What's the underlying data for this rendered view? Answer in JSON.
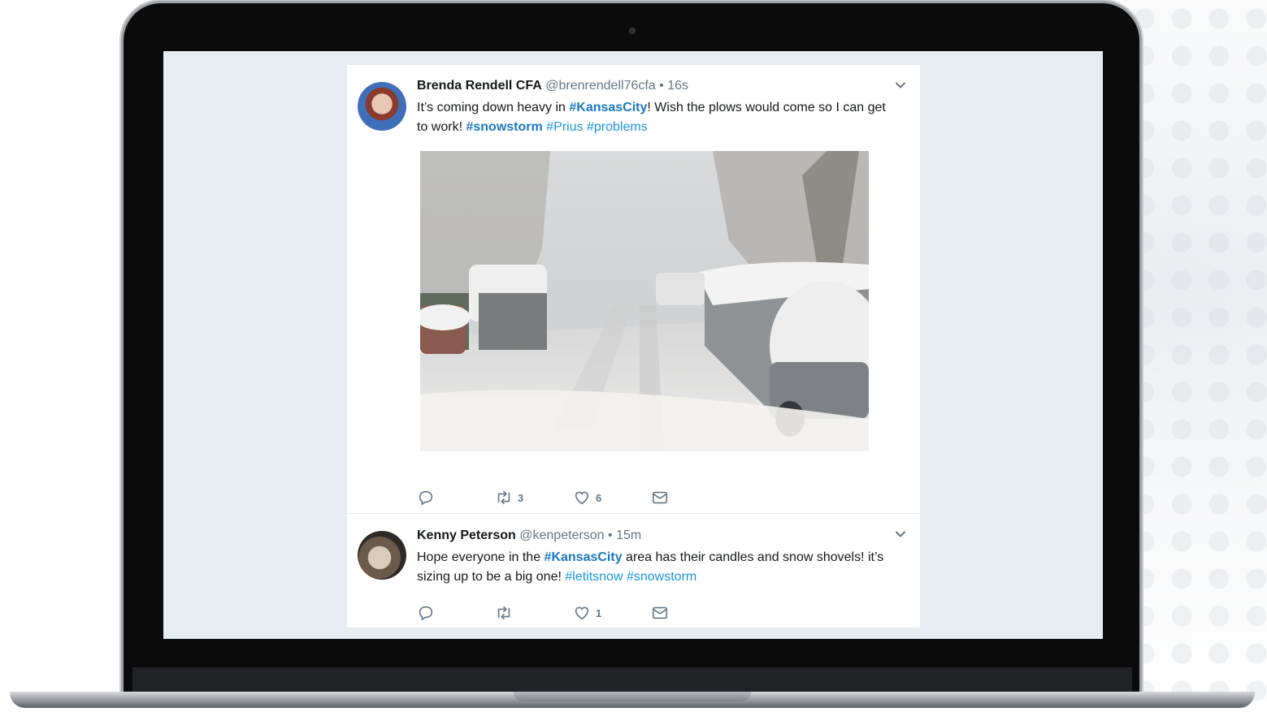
{
  "tweets": [
    {
      "name": "Brenda Rendell CFA",
      "handle": "@brenrendell76cfa",
      "separator": "•",
      "time": "16s",
      "text_parts": [
        "It’s coming down heavy in ",
        "#KansasCity",
        "!  Wish the plows would come so I can get to work!  ",
        "#snowstorm",
        " ",
        "#Prius",
        " ",
        "#problems"
      ],
      "media": "snowy-street-photo",
      "actions": {
        "reply_count": "",
        "retweet_count": "3",
        "like_count": "6"
      }
    },
    {
      "name": "Kenny Peterson",
      "handle": "@kenpeterson",
      "separator": "•",
      "time": "15m",
      "text_parts": [
        "Hope everyone in the ",
        "#KansasCity",
        " area has their candles and snow shovels! it’s sizing up to be a big one! ",
        "#letitsnow",
        " ",
        "#snowstorm"
      ],
      "actions": {
        "reply_count": "",
        "retweet_count": "",
        "like_count": "1"
      }
    }
  ],
  "icons": [
    "reply-icon",
    "retweet-icon",
    "like-icon",
    "direct-message-icon",
    "chevron-down-icon",
    "camera-icon"
  ],
  "colors": {
    "link": "#1b95e0",
    "feed_bg": "#e6ecf0",
    "text": "#14171a",
    "muted": "#657786"
  }
}
